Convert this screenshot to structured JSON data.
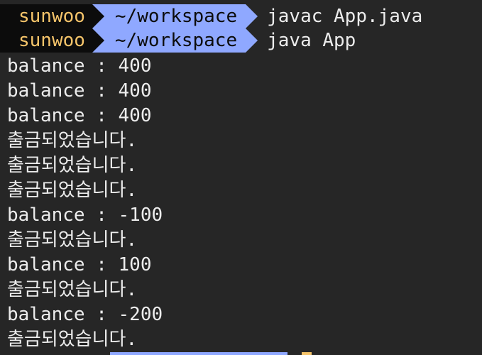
{
  "prompts": [
    {
      "user": "sunwoo",
      "dir": "~/workspace",
      "command": "javac App.java"
    },
    {
      "user": "sunwoo",
      "dir": "~/workspace",
      "command": "java App"
    }
  ],
  "output": [
    "balance : 400",
    "balance : 400",
    "balance : 400",
    "출금되었습니다.",
    "출금되었습니다.",
    "출금되었습니다.",
    "balance : -100",
    "출금되었습니다.",
    "balance : 100",
    "출금되었습니다.",
    "balance : -200",
    "출금되었습니다."
  ],
  "colors": {
    "background": "#262626",
    "user_segment_bg": "#0c0c0c",
    "user_text": "#f5c46a",
    "dir_segment_bg": "#8fa8ff",
    "text": "#ececec"
  }
}
